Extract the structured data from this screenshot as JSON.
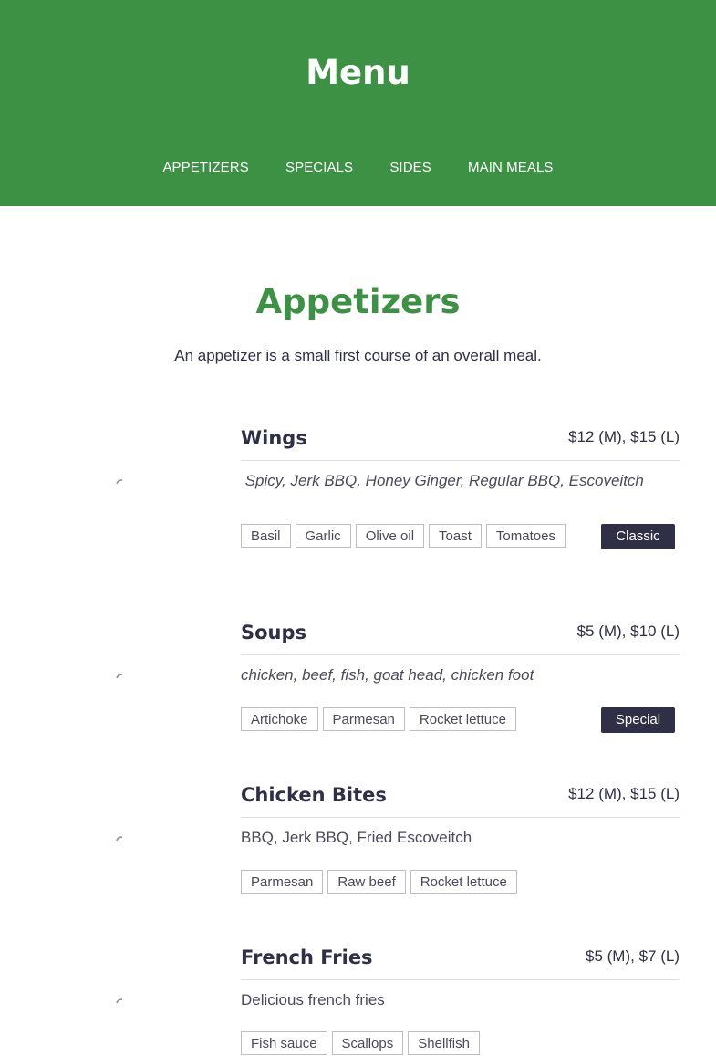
{
  "header": {
    "title": "Menu",
    "nav": [
      "APPETIZERS",
      "SPECIALS",
      "SIDES",
      "MAIN MEALS"
    ]
  },
  "section": {
    "title": "Appetizers",
    "description": "An appetizer is a small first course of an overall meal."
  },
  "items": [
    {
      "name": "Wings",
      "price": "$12 (M), $15 (L)",
      "description": " Spicy, Jerk BBQ, Honey Ginger, Regular BBQ, Escoveitch",
      "tags": [
        "Basil",
        "Garlic",
        "Olive oil",
        "Toast",
        "Tomatoes"
      ],
      "badge": "Classic"
    },
    {
      "name": "Soups",
      "price": "$5 (M), $10 (L)",
      "description": "chicken, beef, fish, goat head, chicken foot",
      "tags": [
        "Artichoke",
        "Parmesan",
        "Rocket lettuce"
      ],
      "badge": "Special"
    },
    {
      "name": "Chicken Bites",
      "price": "$12 (M), $15 (L)",
      "description": "BBQ, Jerk BBQ, Fried Escoveitch",
      "tags": [
        "Parmesan",
        "Raw beef",
        "Rocket lettuce"
      ]
    },
    {
      "name": "French Fries",
      "price": "$5 (M), $7 (L)",
      "description": "Delicious french fries",
      "tags": [
        "Fish sauce",
        "Scallops",
        "Shellfish"
      ]
    }
  ],
  "colors": {
    "brand_green": "#3d9145",
    "dark": "#2f2f45",
    "white": "#ffffff"
  }
}
